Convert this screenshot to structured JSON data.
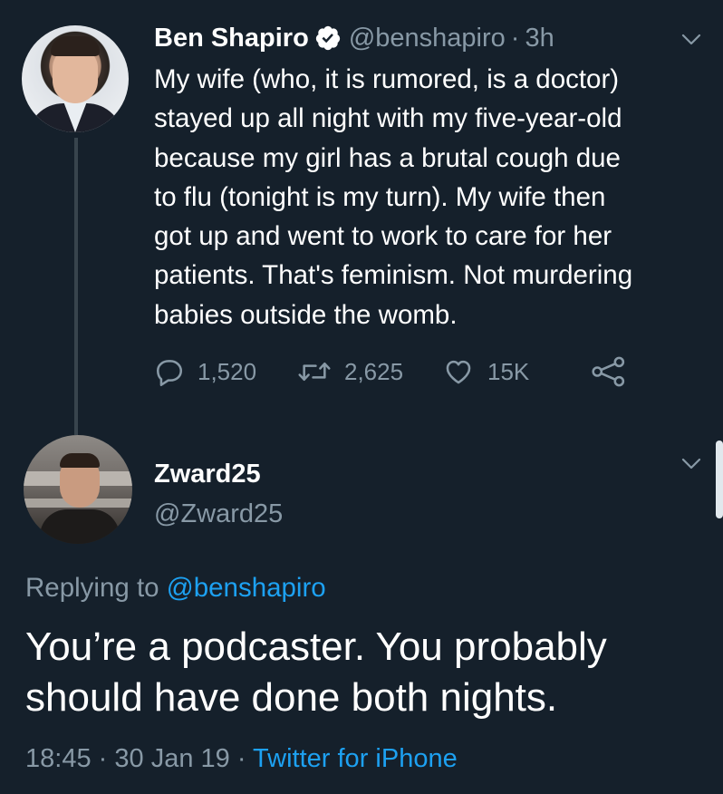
{
  "tweet": {
    "display_name": "Ben Shapiro",
    "handle": "@benshapiro",
    "separator": "·",
    "time": "3h",
    "text": "My wife (who, it is rumored, is a doctor)\nstayed up all night with my five-year-old\nbecause my girl has a brutal cough due\nto flu (tonight is my turn). My wife then\ngot up and went to work to care for her\npatients. That's feminism. Not murdering\nbabies outside the womb.",
    "actions": {
      "replies": "1,520",
      "retweets": "2,625",
      "likes": "15K"
    },
    "icons": {
      "verified": "verified-badge-icon",
      "reply": "reply-icon",
      "retweet": "retweet-icon",
      "like": "heart-icon",
      "share": "share-icon",
      "menu": "chevron-down-icon"
    }
  },
  "reply": {
    "display_name": "Zward25",
    "handle": "@Zward25",
    "replying_prefix": "Replying to",
    "replying_to": "@benshapiro",
    "text": "You’re a podcaster. You probably\nshould have done both nights.",
    "time": "18:45",
    "date": "30 Jan 19",
    "source": "Twitter for iPhone",
    "separator": "·"
  },
  "colors": {
    "background": "#15202b",
    "text": "#ffffff",
    "secondary": "#8899a6",
    "accent": "#1da1f2",
    "thread_line": "#38444d"
  }
}
